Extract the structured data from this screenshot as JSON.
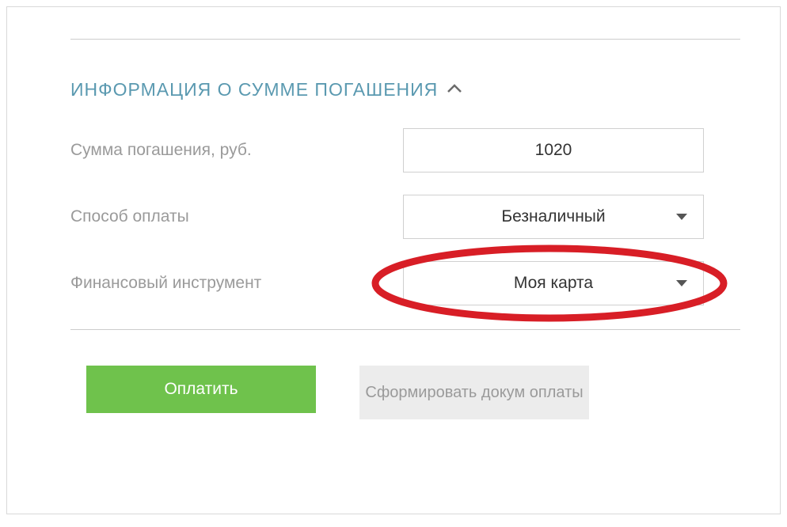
{
  "section": {
    "title": "ИНФОРМАЦИЯ О СУММЕ ПОГАШЕНИЯ"
  },
  "form": {
    "amount": {
      "label": "Сумма погашения, руб.",
      "value": "1020"
    },
    "paymentMethod": {
      "label": "Способ оплаты",
      "value": "Безналичный"
    },
    "financialInstrument": {
      "label": "Финансовый инструмент",
      "value": "Моя карта"
    }
  },
  "buttons": {
    "pay": "Оплатить",
    "generate": "Сформировать докум\nоплаты"
  }
}
